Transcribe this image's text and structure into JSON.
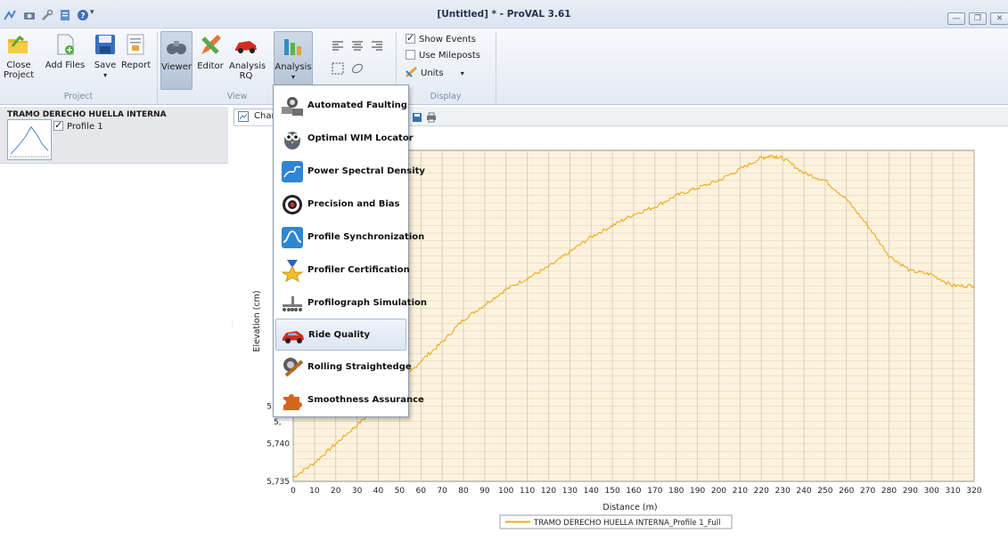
{
  "window": {
    "title": "[Untitled] * - ProVAL 3.61",
    "controls": [
      "minimize",
      "restore",
      "close"
    ]
  },
  "ribbon": {
    "project": {
      "label": "Project",
      "close_project": "Close Project",
      "add_files": "Add Files",
      "save": "Save",
      "report": "Report"
    },
    "view": {
      "label": "View",
      "viewer": "Viewer",
      "editor": "Editor",
      "analysis_rq": "Analysis RQ",
      "analysis": "Analysis"
    },
    "display": {
      "label": "Display",
      "show_events": "Show Events",
      "show_events_checked": true,
      "use_mileposts": "Use Mileposts",
      "use_mileposts_checked": false,
      "units": "Units"
    }
  },
  "left_panel": {
    "project_name": "TRAMO DERECHO HUELLA INTERNA",
    "profile_label": "Profile 1",
    "profile_checked": true
  },
  "chart_tab": {
    "label": "Chart"
  },
  "analysis_menu": {
    "items": [
      {
        "label": "Automated Faulting",
        "icon": "faulting-icon"
      },
      {
        "label": "Optimal WIM Locator",
        "icon": "owl-icon"
      },
      {
        "label": "Power Spectral Density",
        "icon": "psd-icon"
      },
      {
        "label": "Precision and Bias",
        "icon": "target-icon"
      },
      {
        "label": "Profile Synchronization",
        "icon": "sync-wave-icon"
      },
      {
        "label": "Profiler Certification",
        "icon": "medal-icon"
      },
      {
        "label": "Profilograph Simulation",
        "icon": "profilograph-icon"
      },
      {
        "label": "Ride Quality",
        "icon": "car-icon"
      },
      {
        "label": "Rolling Straightedge",
        "icon": "straightedge-icon"
      },
      {
        "label": "Smoothness Assurance",
        "icon": "puzzle-icon"
      }
    ],
    "highlighted_index": 7
  },
  "chart_data": {
    "type": "line",
    "xlabel": "Distance (m)",
    "ylabel": "Elevation (cm)",
    "xlim": [
      0,
      320
    ],
    "ylim": [
      5735,
      5779
    ],
    "x_ticks": [
      0,
      10,
      20,
      30,
      40,
      50,
      60,
      70,
      80,
      90,
      100,
      110,
      120,
      130,
      140,
      150,
      160,
      170,
      180,
      190,
      200,
      210,
      220,
      230,
      240,
      250,
      260,
      270,
      280,
      290,
      300,
      310,
      320
    ],
    "y_tick_labels_visible": [
      "5,745",
      "5,740",
      "5,735"
    ],
    "y_tick_labels_clipped": [
      "5,",
      "5,",
      "5,",
      "5,",
      "5,",
      "5,",
      "5,",
      "5,",
      "5,"
    ],
    "grid": true,
    "plot_background": "#fdf3dc",
    "legend_position": "bottom",
    "series": [
      {
        "name": "TRAMO DERECHO HUELLA INTERNA_Profile 1_Full",
        "color": "#f2a81e",
        "x": [
          0,
          10,
          20,
          30,
          40,
          50,
          60,
          70,
          80,
          90,
          100,
          110,
          120,
          130,
          140,
          150,
          160,
          170,
          180,
          190,
          200,
          210,
          220,
          225,
          230,
          240,
          250,
          260,
          270,
          280,
          290,
          300,
          310,
          320
        ],
        "values": [
          5735.5,
          5737.5,
          5740,
          5742.5,
          5745,
          5748,
          5751,
          5753.5,
          5756.5,
          5758.5,
          5760.5,
          5762,
          5763.5,
          5765.5,
          5767.5,
          5769,
          5770.5,
          5771.5,
          5773,
          5774,
          5775,
          5776.5,
          5778,
          5778.3,
          5778,
          5776,
          5775,
          5772.5,
          5769,
          5765,
          5763,
          5762.5,
          5761,
          5761
        ]
      }
    ]
  }
}
